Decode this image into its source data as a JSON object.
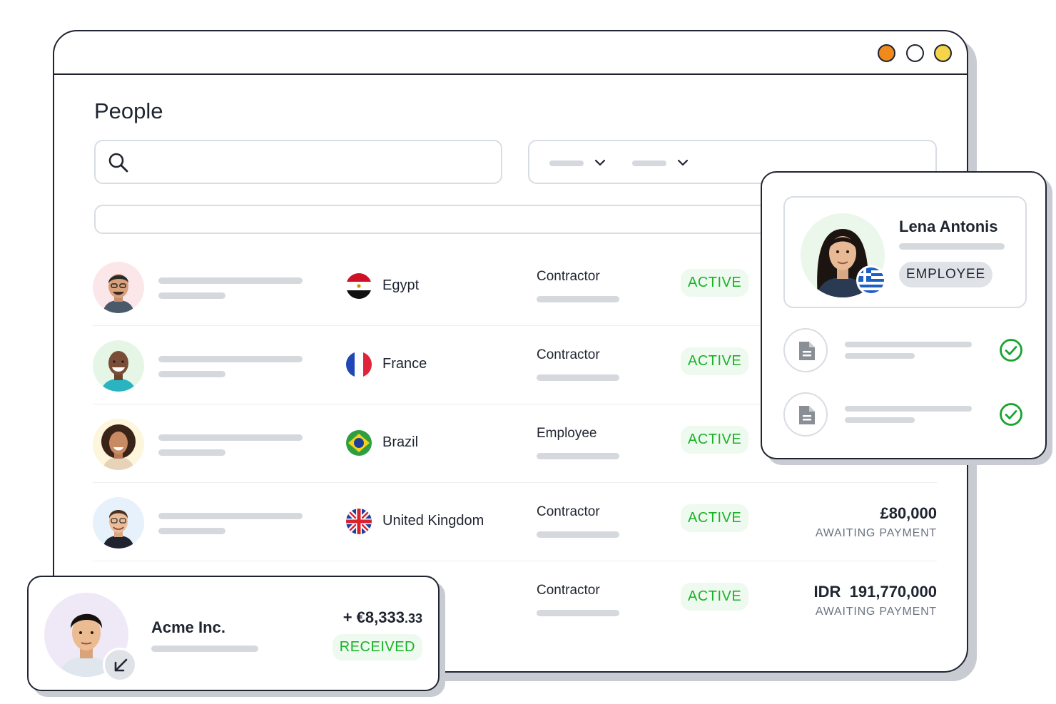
{
  "window": {
    "controls": [
      {
        "name": "close",
        "color": "#f08a1c"
      },
      {
        "name": "minimize",
        "color": "#ffffff"
      },
      {
        "name": "maximize",
        "color": "#f5d44a"
      }
    ]
  },
  "page": {
    "title": "People",
    "search": {
      "placeholder": ""
    }
  },
  "colors": {
    "active_green": "#18b325",
    "ink": "#1f2430",
    "placeholder_gray": "#d5d9de"
  },
  "people": [
    {
      "country": "Egypt",
      "flag_icon": "egypt-flag-icon",
      "role": "Contractor",
      "status": "ACTIVE"
    },
    {
      "country": "France",
      "flag_icon": "france-flag-icon",
      "role": "Contractor",
      "status": "ACTIVE"
    },
    {
      "country": "Brazil",
      "flag_icon": "brazil-flag-icon",
      "role": "Employee",
      "status": "ACTIVE"
    },
    {
      "country": "United Kingdom",
      "flag_icon": "uk-flag-icon",
      "role": "Contractor",
      "status": "ACTIVE",
      "amount": "£80,000",
      "amount_status": "AWAITING PAYMENT"
    },
    {
      "role": "Contractor",
      "status": "ACTIVE",
      "amount": "IDR  191,770,000",
      "amount_status": "AWAITING PAYMENT"
    }
  ],
  "profile_card": {
    "name": "Lena Antonis",
    "badge": "EMPLOYEE",
    "flag_icon": "greece-flag-icon",
    "documents": [
      {
        "icon": "document-icon",
        "status_icon": "check-circle-icon"
      },
      {
        "icon": "document-icon",
        "status_icon": "check-circle-icon"
      }
    ]
  },
  "payment_card": {
    "name": "Acme Inc.",
    "amount_main": "+ €8,333",
    "amount_cents": ".33",
    "status": "RECEIVED",
    "icon": "arrow-down-left-icon"
  }
}
